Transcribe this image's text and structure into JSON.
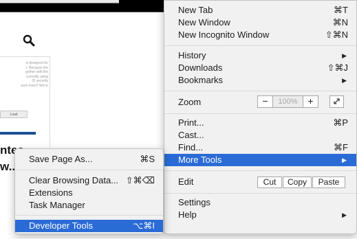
{
  "background_page": {
    "tiny_text_lines": [
      "is designed for",
      "r. Because the",
      "gether with the",
      "currently using",
      "ID security",
      "earn more? We're"
    ],
    "button_label": "Load",
    "headline_line1": "ntes",
    "headline_line2": "w..."
  },
  "main_menu": {
    "new_tab": {
      "label": "New Tab",
      "shortcut": "⌘T"
    },
    "new_window": {
      "label": "New Window",
      "shortcut": "⌘N"
    },
    "new_incognito": {
      "label": "New Incognito Window",
      "shortcut": "⇧⌘N"
    },
    "history": {
      "label": "History"
    },
    "downloads": {
      "label": "Downloads",
      "shortcut": "⇧⌘J"
    },
    "bookmarks": {
      "label": "Bookmarks"
    },
    "zoom": {
      "label": "Zoom",
      "minus": "−",
      "value": "100%",
      "plus": "+"
    },
    "print": {
      "label": "Print...",
      "shortcut": "⌘P"
    },
    "cast": {
      "label": "Cast..."
    },
    "find": {
      "label": "Find...",
      "shortcut": "⌘F"
    },
    "more_tools": {
      "label": "More Tools"
    },
    "edit": {
      "label": "Edit",
      "cut": "Cut",
      "copy": "Copy",
      "paste": "Paste"
    },
    "settings": {
      "label": "Settings"
    },
    "help": {
      "label": "Help"
    }
  },
  "sub_menu": {
    "save_page_as": {
      "label": "Save Page As...",
      "shortcut": "⌘S"
    },
    "clear_browsing_data": {
      "label": "Clear Browsing Data...",
      "shortcut": "⇧⌘⌫"
    },
    "extensions": {
      "label": "Extensions"
    },
    "task_manager": {
      "label": "Task Manager"
    },
    "developer_tools": {
      "label": "Developer Tools",
      "shortcut": "⌥⌘I"
    }
  },
  "icons": {
    "submenu_arrow": "▶",
    "search": "search-icon",
    "fullscreen": "fullscreen-icon"
  },
  "colors": {
    "highlight": "#2a6bd6",
    "menu_background": "#f1f1f1",
    "page_accent": "#1d4f9a"
  }
}
